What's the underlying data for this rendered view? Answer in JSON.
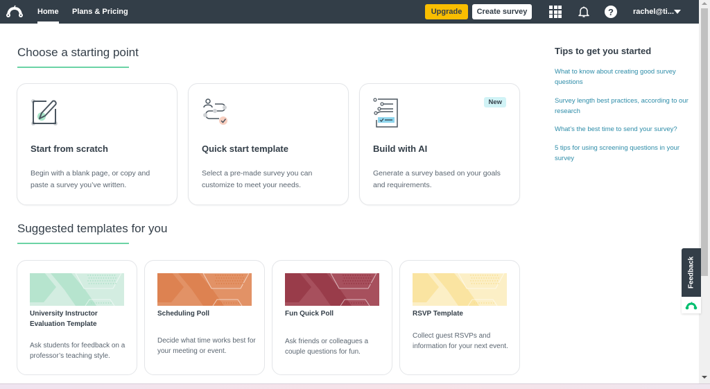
{
  "nav": {
    "logo_icon": "surveymonkey-logo-icon",
    "home": "Home",
    "plans": "Plans & Pricing",
    "upgrade": "Upgrade",
    "create_survey": "Create survey",
    "apps_icon": "apps-grid-icon",
    "notifications_icon": "bell-icon",
    "help_icon": "help-icon",
    "help_glyph": "?",
    "user": "rachel@ti..."
  },
  "start": {
    "heading": "Choose a starting point",
    "cards": [
      {
        "title": "Start from scratch",
        "desc": "Begin with a blank page, or copy and paste a survey you’ve written.",
        "icon": "edit-page-icon"
      },
      {
        "title": "Quick start template",
        "desc": "Select a pre-made survey you can customize to meet your needs.",
        "icon": "template-flow-icon"
      },
      {
        "title": "Build with AI",
        "desc": "Generate a survey based on your goals and requirements.",
        "icon": "ai-build-icon",
        "badge": "New"
      }
    ]
  },
  "templates": {
    "heading": "Suggested templates for you",
    "cards": [
      {
        "title": "University Instructor Evaluation Template",
        "desc": "Ask students for feedback on a professor’s teaching style.",
        "color": "#d3ede1",
        "accent": "#9fdcbf"
      },
      {
        "title": "Scheduling Poll",
        "desc": "Decide what time works best for your meeting or event.",
        "color": "#e29266",
        "accent": "#d9753f"
      },
      {
        "title": "Fun Quick Poll",
        "desc": "Ask friends or colleagues a couple questions for fun.",
        "color": "#a7505d",
        "accent": "#8e2b3b"
      },
      {
        "title": "RSVP Template",
        "desc": "Collect guest RSVPs and information for your next event.",
        "color": "#fcefc6",
        "accent": "#f7da84"
      }
    ]
  },
  "tips": {
    "heading": "Tips to get you started",
    "links": [
      "What to know about creating good survey questions",
      "Survey length best practices, according to our research",
      "What’s the best time to send your survey?",
      "5 tips for using screening questions in your survey"
    ]
  },
  "feedback": {
    "label": "Feedback"
  },
  "colors": {
    "nav_bg": "#333e48",
    "upgrade": "#f9be00",
    "accent_green": "#6bd3a5",
    "link": "#2d8ca8"
  }
}
